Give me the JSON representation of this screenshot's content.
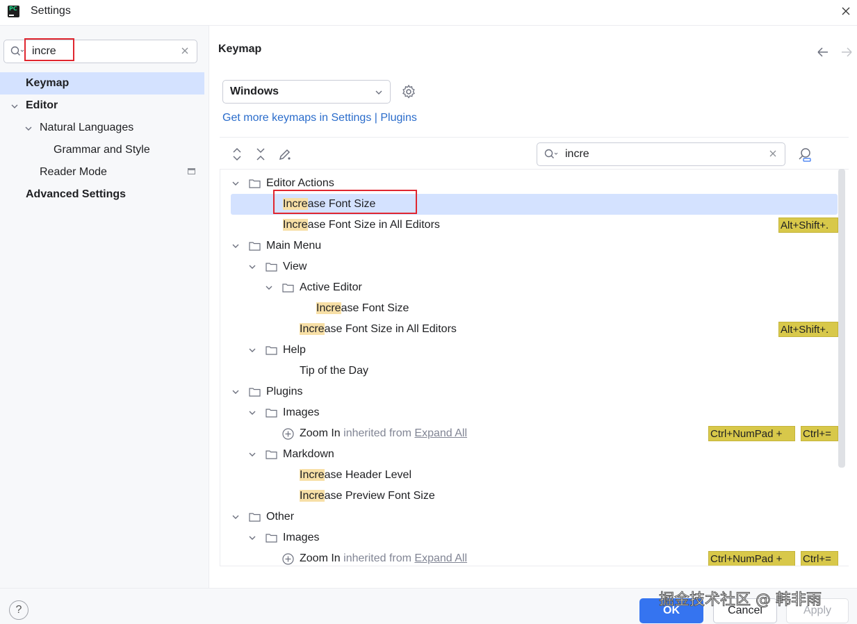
{
  "window": {
    "title": "Settings",
    "app_icon": "pycharm-icon"
  },
  "sidebar": {
    "search_value": "incre",
    "items": [
      {
        "label": "Keymap"
      },
      {
        "label": "Editor"
      },
      {
        "label": "Natural Languages"
      },
      {
        "label": "Grammar and Style"
      },
      {
        "label": "Reader Mode"
      },
      {
        "label": "Advanced Settings"
      }
    ]
  },
  "main": {
    "title": "Keymap",
    "keymap_value": "Windows",
    "plugins_link": "Get more keymaps in Settings | Plugins",
    "action_search_value": "incre",
    "tree": {
      "editor_actions": "Editor Actions",
      "increase_font_size_a": "ase Font Size",
      "increase_all_editors_a": "ase Font Size in All Editors",
      "main_menu": "Main Menu",
      "view": "View",
      "active_editor": "Active Editor",
      "increase_font_size_b": "ase Font Size",
      "increase_all_editors_b": "ase Font Size in All Editors",
      "help": "Help",
      "tip_of_day": "Tip of the Day",
      "plugins": "Plugins",
      "images_a": "Images",
      "zoom_in_a": "Zoom In",
      "markdown": "Markdown",
      "increase_header": "ase Header Level",
      "increase_preview": "ase Preview Font Size",
      "other": "Other",
      "images_b": "Images",
      "zoom_in_b": "Zoom In",
      "match_text": "Incre",
      "inherited_text": "inherited from",
      "expand_all": "Expand All",
      "shortcut_alt_shift": "Alt+Shift+.",
      "shortcut_ctrl_numpad": "Ctrl+NumPad +",
      "shortcut_ctrl_eq": "Ctrl+="
    }
  },
  "footer": {
    "help": "?",
    "ok": "OK",
    "cancel": "Cancel",
    "apply": "Apply"
  },
  "watermark": "掘金技术社区 @ 韩非雨",
  "colors": {
    "selection": "#d4e2ff",
    "match_highlight": "#f7dfa6",
    "shortcut_bg": "#d8c84a",
    "link": "#2a6ccb",
    "primary_button": "#3574f0",
    "annotation_red": "#e0262f"
  }
}
